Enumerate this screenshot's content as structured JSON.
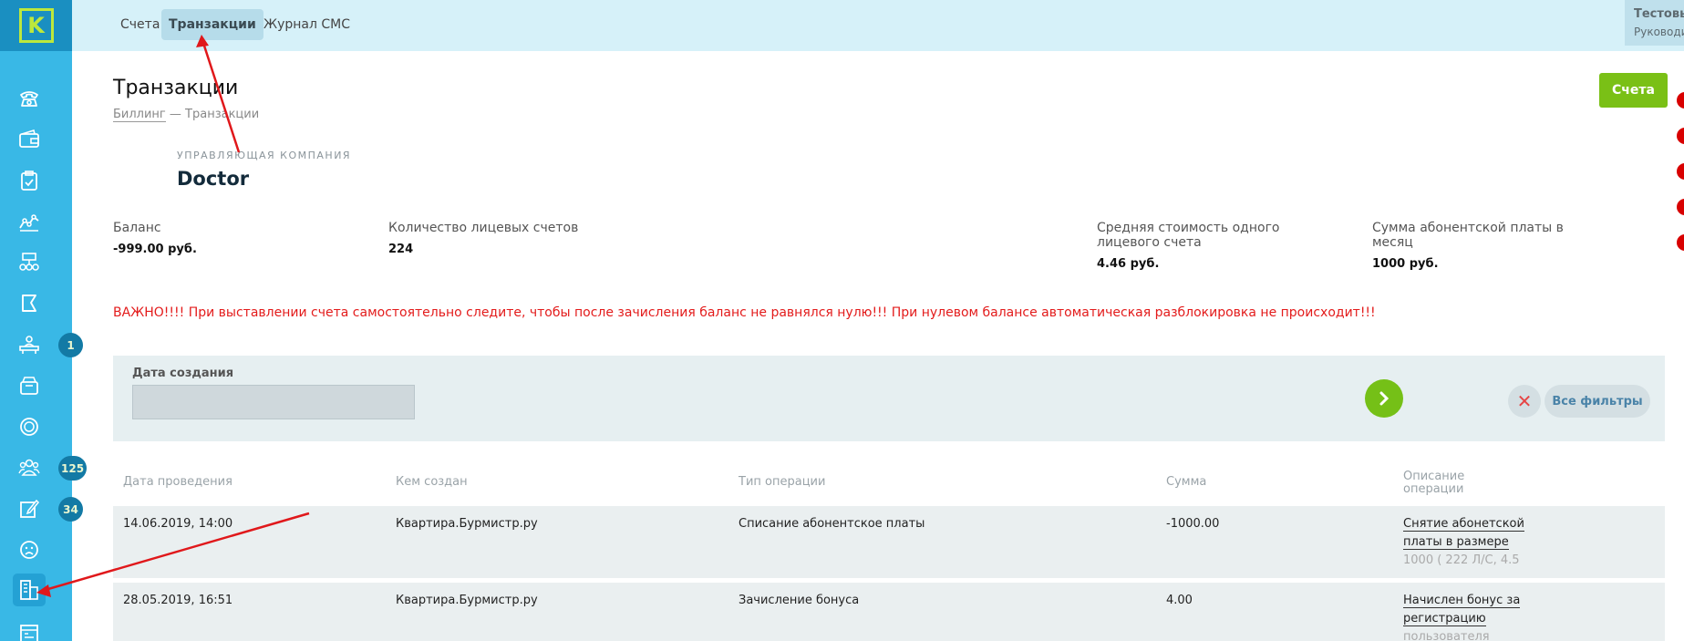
{
  "logo": {
    "letter": "K"
  },
  "sidebar": {
    "items": [
      {
        "name": "phone-icon"
      },
      {
        "name": "wallet-icon"
      },
      {
        "name": "clipboard-check-icon"
      },
      {
        "name": "analytics-icon"
      },
      {
        "name": "org-structure-icon"
      },
      {
        "name": "flag-icon"
      },
      {
        "name": "reception-icon",
        "badge": "1"
      },
      {
        "name": "archive-icon"
      },
      {
        "name": "coin-icon"
      },
      {
        "name": "users-icon",
        "badge": "125"
      },
      {
        "name": "edit-icon",
        "badge": "34"
      },
      {
        "name": "sad-face-icon"
      },
      {
        "name": "billing-icon",
        "active": true
      },
      {
        "name": "calendar-list-icon"
      }
    ]
  },
  "header": {
    "tabs": [
      {
        "label": "Счета",
        "active": false
      },
      {
        "label": "Транзакции",
        "active": true
      },
      {
        "label": "Журнал СМС",
        "active": false
      }
    ],
    "user": {
      "name": "Тестовый Д. Р.",
      "role": "Руководитель, Doctor"
    }
  },
  "page": {
    "title": "Транзакции",
    "breadcrumb": {
      "parent": "Биллинг",
      "separator": "—",
      "current": "Транзакции"
    },
    "accounts_button": "Счета"
  },
  "company": {
    "label": "УПРАВЛЯЮЩАЯ КОМПАНИЯ",
    "name": "Doctor"
  },
  "stats": [
    {
      "label": "Баланс",
      "value": "-999.00 руб."
    },
    {
      "label": "Количество лицевых счетов",
      "value": "224"
    },
    {
      "label": "Средняя стоимость одного лицевого счета",
      "value": "4.46 руб."
    },
    {
      "label": "Сумма абонентской платы в месяц",
      "value": "1000 руб."
    }
  ],
  "warning": "ВАЖНО!!!! При выставлении счета самостоятельно следите, чтобы после зачисления баланс не равнялся нулю!!! При нулевом балансе автоматическая разблокировка не происходит!!!",
  "filter": {
    "date_label": "Дата создания",
    "all_filters": "Все фильтры"
  },
  "table": {
    "headers": [
      "Дата проведения",
      "Кем создан",
      "Тип операции",
      "Сумма",
      "Описание операции"
    ],
    "rows": [
      {
        "date": "14.06.2019, 14:00",
        "creator": "Квартира.Бурмистр.ру",
        "type": "Списание абонентское платы",
        "amount": "-1000.00",
        "desc": [
          "Снятие абонетской",
          "платы в размере",
          "1000 ( 222 Л/С, 4.5"
        ]
      },
      {
        "date": "28.05.2019, 16:51",
        "creator": "Квартира.Бурмистр.ру",
        "type": "Зачисление бонуса",
        "amount": "4.00",
        "desc": [
          "Начислен бонус за",
          "регистрацию",
          "пользователя"
        ]
      }
    ]
  },
  "colors": {
    "sidebar": "#39b8e6",
    "accent_green": "#7ac016",
    "warning_red": "#e31b1b",
    "arrow_red": "#e0181b"
  }
}
